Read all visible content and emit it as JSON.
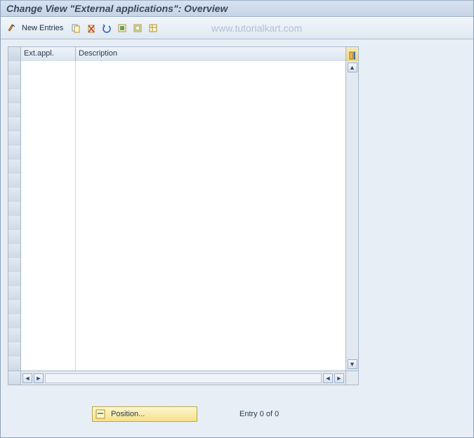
{
  "title": "Change View \"External applications\": Overview",
  "toolbar": {
    "new_entries": "New Entries"
  },
  "watermark": "www.tutorialkart.com",
  "table": {
    "columns": {
      "ext_appl": "Ext.appl.",
      "description": "Description"
    },
    "row_count": 22
  },
  "footer": {
    "position_label": "Position...",
    "entry_text": "Entry 0 of 0"
  }
}
